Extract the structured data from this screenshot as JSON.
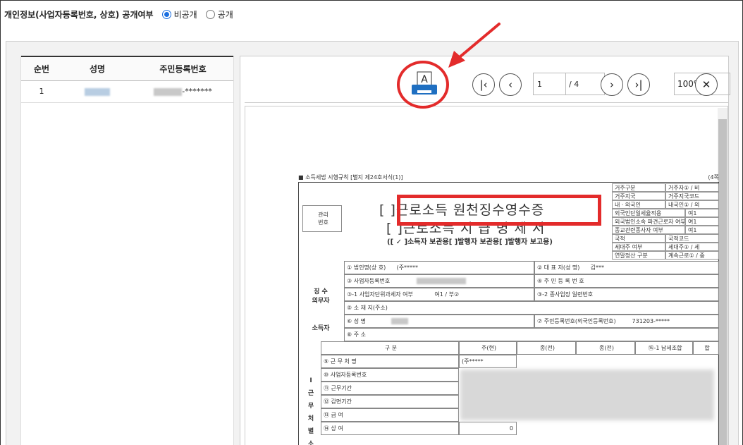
{
  "privacy": {
    "label": "개인정보(사업자등록번호, 상호) 공개여부",
    "options": [
      {
        "label": "비공개",
        "selected": true
      },
      {
        "label": "공개",
        "selected": false
      }
    ]
  },
  "list": {
    "columns": [
      "순번",
      "성명",
      "주민등록번호"
    ],
    "rows": [
      {
        "no": "1",
        "name": "",
        "rrn_suffix": "-*******"
      }
    ]
  },
  "viewer": {
    "print_icon_letter": "A",
    "current_page": "1",
    "total_pages": "/ 4",
    "zoom": "100%"
  },
  "form": {
    "header_left": "■ 소득세법 시행규칙 [별지 제24호서식(1)]",
    "header_right": "(4쪽",
    "title1": "[  ]근로소득 원천징수영수증",
    "title2": "[  ]근로소득 지 급 명 세 서",
    "copy_types": "([ ✓ ]소득자 보관용[       ]발행자 보관용[       ]발행자 보고용)",
    "mgmt_label": "관리\n번호",
    "withholder_label": "징 수\n의무자",
    "earner_label": "소득자",
    "rows": {
      "company": "① 법인명(상 호)",
      "company_val": "(주*****",
      "ceo": "② 대 표 자(성  명)",
      "ceo_val": "김***",
      "bizno": "③ 사업자등록번호",
      "rrn": "④ 주 민 등 록 번 호",
      "unit_tax": "③-1 사업자단위과세자 여부",
      "unit_tax_val": "여1 / 부②",
      "branch": "③-2 종사업장 일련번호",
      "address": "⑤ 소 재 지(주소)",
      "earner_name": "⑥ 성       명",
      "earner_rrn": "⑦ 주민등록번호(외국인등록번호)",
      "earner_rrn_val": "731203-*****",
      "earner_addr": "⑧ 주       소"
    },
    "table": {
      "headers": [
        "구   분",
        "주(현)",
        "종(전)",
        "종(전)",
        "⑯-1 납세조합",
        "합"
      ],
      "rows": [
        "⑨ 근 무 처 명",
        "⑩ 사업자등록번호",
        "⑪ 근무기간",
        "⑫ 감면기간",
        "⑬ 급        여",
        "⑭ 상        여"
      ],
      "first_col_val": "(주*****",
      "bonus_val": "0"
    },
    "side_label": "Ⅰ\n근\n무\n처\n별\n소",
    "right_cells": [
      "거주구분",
      "거주자① / 비",
      "거주지국",
      "거주지국코드",
      "내ㆍ외국인",
      "내국인① / 외",
      "외국인단일세율적용",
      "여1",
      "외국법인소속 파견근로자 여부",
      "여1",
      "종교관련종사자 여부",
      "여1",
      "국적",
      "국적코드",
      "세대주 여부",
      "세대주① / 세",
      "연말정산 구분",
      "계속근로① / 중"
    ]
  }
}
